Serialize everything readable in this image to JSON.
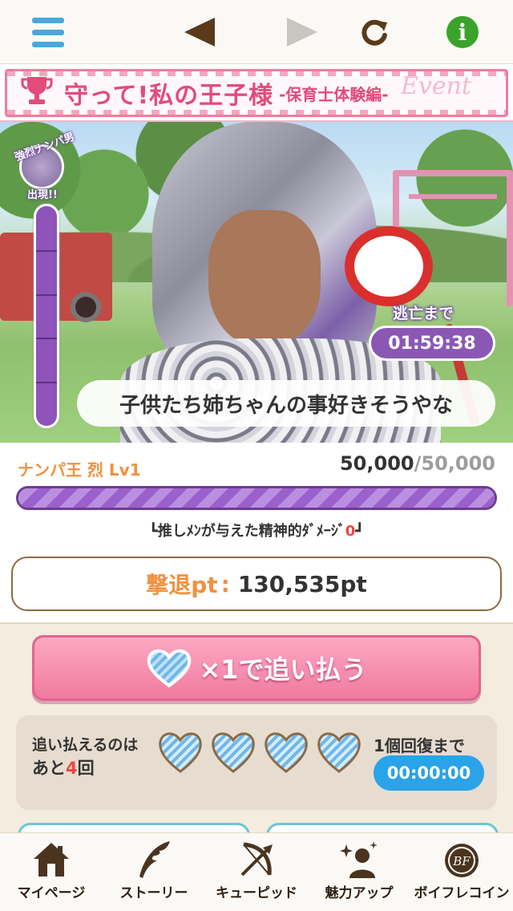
{
  "event": {
    "title": "守って!私の王子様",
    "subtitle": "-保育士体験編-",
    "deco": "Event"
  },
  "scene": {
    "gauge_top_label": "強烈ナンパ男",
    "gauge_bottom_label": "出現!!",
    "gauge_level": 1.0,
    "gauge_segments": 5,
    "timer_label": "逃亡まで",
    "timer_value": "01:59:38",
    "speech": "子供たち姉ちゃんの事好きそうやな"
  },
  "boss": {
    "name": "ナンパ王 烈 Lv1",
    "hp_current": "50,000",
    "hp_max": "/50,000",
    "hp_fraction": 1.0,
    "damage_label": "┗推しﾒﾝが与えた精神的ﾀﾞﾒｰｼﾞ",
    "damage_value": "0",
    "damage_end": "┛"
  },
  "points": {
    "label": "撃退pt",
    "colon": ":",
    "value": "130,535pt"
  },
  "attack": {
    "label": "×1で追い払う",
    "icon": "heart-icon"
  },
  "remaining": {
    "line1": "追い払えるのは",
    "line2_prefix": "あと",
    "count": "4",
    "line2_suffix": "回",
    "recover_label": "1個回復まで",
    "recover_timer": "00:00:00"
  },
  "nav": {
    "items": [
      {
        "label": "マイページ",
        "icon": "house-icon"
      },
      {
        "label": "ストーリー",
        "icon": "quill-icon"
      },
      {
        "label": "キューピッド",
        "icon": "bow-icon"
      },
      {
        "label": "魅力アップ",
        "icon": "sparkle-person-icon"
      },
      {
        "label": "ボイフレコイン",
        "icon": "coin-icon"
      }
    ]
  },
  "colors": {
    "accent_pink": "#f07aa0",
    "accent_purple": "#8a58b4",
    "accent_orange": "#f0913f",
    "accent_blue": "#2ba3e8"
  }
}
